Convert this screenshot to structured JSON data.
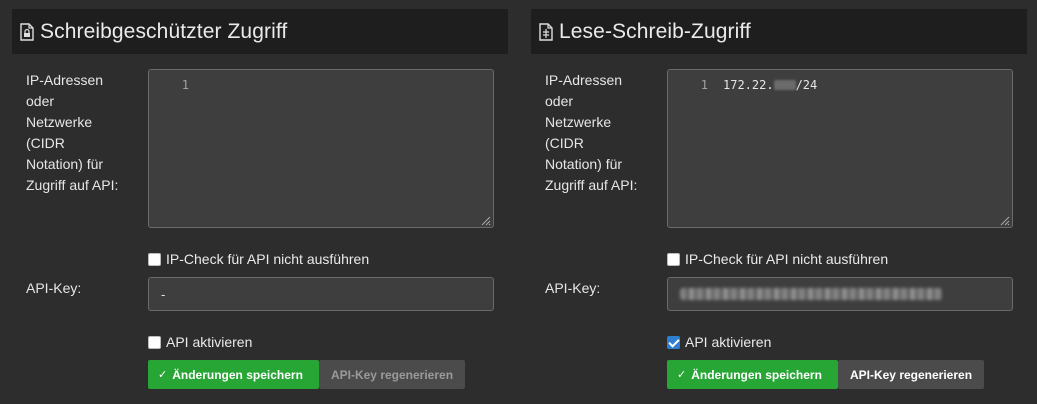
{
  "panels": [
    {
      "title": "Schreibgeschützter Zugriff",
      "ip_label": "IP-Adressen oder Netzwerke (CIDR Notation) für Zugriff auf API:",
      "ip_label_lines": [
        "IP-Adressen",
        "oder",
        "Netzwerke",
        "(CIDR",
        "Notation) für",
        "Zugriff auf API:"
      ],
      "editor": {
        "line_number": "1",
        "code_prefix": "",
        "code_suffix": ""
      },
      "ip_check_label": "IP-Check für API nicht ausführen",
      "ip_check_checked": false,
      "api_key_label": "API-Key:",
      "api_key_value": "-",
      "api_activate_label": "API aktivieren",
      "api_activate_checked": false,
      "save_label": "Änderungen speichern",
      "regen_label": "API-Key regenerieren",
      "regen_enabled": false
    },
    {
      "title": "Lese-Schreib-Zugriff",
      "ip_label": "IP-Adressen oder Netzwerke (CIDR Notation) für Zugriff auf API:",
      "ip_label_lines": [
        "IP-Adressen",
        "oder",
        "Netzwerke",
        "(CIDR",
        "Notation) für",
        "Zugriff auf API:"
      ],
      "editor": {
        "line_number": "1",
        "code_prefix": "172.22.",
        "code_suffix": "/24"
      },
      "ip_check_label": "IP-Check für API nicht ausführen",
      "ip_check_checked": false,
      "api_key_label": "API-Key:",
      "api_key_value": "",
      "api_activate_label": "API aktivieren",
      "api_activate_checked": true,
      "save_label": "Änderungen speichern",
      "regen_label": "API-Key regenerieren",
      "regen_enabled": true
    }
  ],
  "icons": {
    "header": "file-lock-icon",
    "save": "check-icon",
    "resize": "resize-grip-icon"
  },
  "colors": {
    "save": "#27a535",
    "checkbox_checked": "#2f7fd0",
    "header_bg": "#1e1e1e",
    "page_bg": "#2d2d2d"
  }
}
